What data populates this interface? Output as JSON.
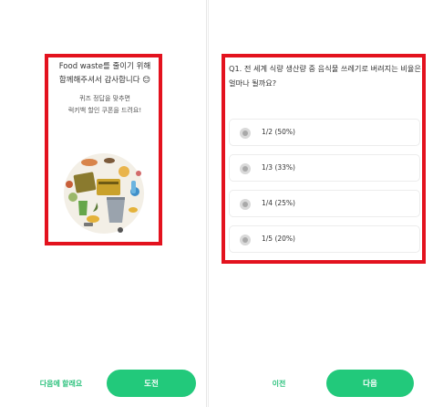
{
  "left_screen": {
    "title_line1": "Food waste를 줄이기 위해",
    "title_line2": "함께해주셔서 감사합니다 😊",
    "sub_line1": "퀴즈 정답을 맞추면",
    "sub_line2": "럭키백 할인 쿠폰을 드려요!",
    "skip_label": "다음에 할래요",
    "try_label": "도전"
  },
  "right_screen": {
    "question": "Q1. 전 세계 식량 생산량 중 음식물 쓰레기로 버려지는 비율은 얼마나 될까요?",
    "options": [
      {
        "label": "1/2 (50%)"
      },
      {
        "label": "1/3 (33%)"
      },
      {
        "label": "1/4 (25%)"
      },
      {
        "label": "1/5 (20%)"
      }
    ],
    "prev_label": "이전",
    "next_label": "다음"
  },
  "colors": {
    "accent": "#22c97b",
    "highlight": "#e3121e"
  }
}
